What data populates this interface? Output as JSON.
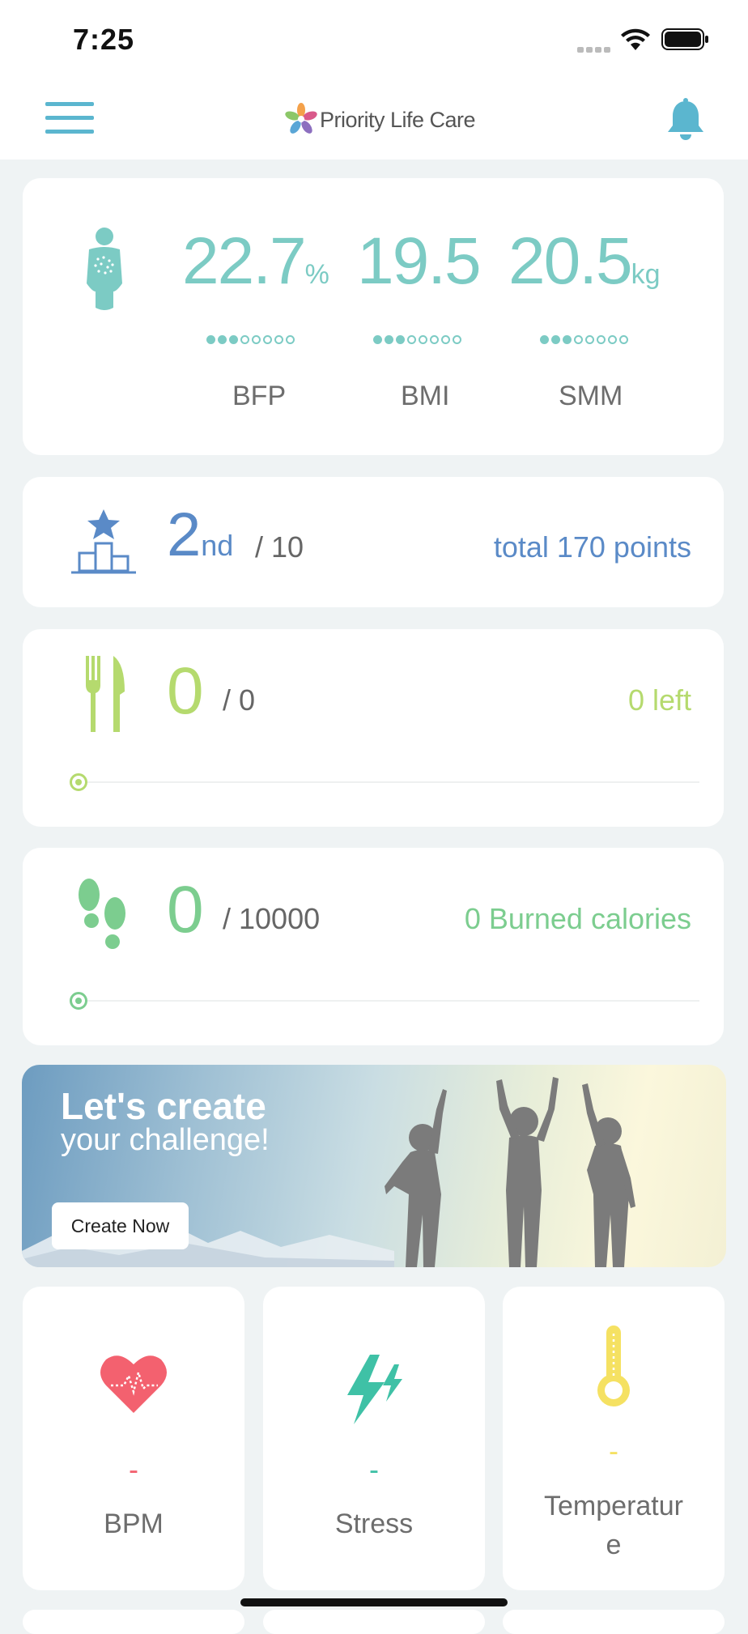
{
  "status": {
    "time": "7:25"
  },
  "header": {
    "brand": "Priority Life Care"
  },
  "body_composition": {
    "bfp": {
      "value": "22.7",
      "unit": "%",
      "label": "BFP"
    },
    "bmi": {
      "value": "19.5",
      "label": "BMI"
    },
    "smm": {
      "value": "20.5",
      "unit": "kg",
      "label": "SMM"
    }
  },
  "rank": {
    "position": "2",
    "suffix": "nd",
    "total": "/ 10",
    "points": "total 170 points"
  },
  "meal": {
    "value": "0",
    "total": "/ 0",
    "left": "0 left"
  },
  "steps": {
    "value": "0",
    "total": "/ 10000",
    "calories": "0 Burned calories"
  },
  "banner": {
    "title": "Let's create",
    "subtitle": "your challenge!",
    "button": "Create Now"
  },
  "vitals": {
    "bpm": {
      "value": "-",
      "label": "BPM"
    },
    "stress": {
      "value": "-",
      "label": "Stress"
    },
    "temperature": {
      "value": "-",
      "label_1": "Temperatur",
      "label_2": "e"
    }
  },
  "colors": {
    "teal": "#7ccbc4",
    "blue": "#5a8ac7",
    "lime": "#b5da6e",
    "green": "#7ccd8f",
    "red": "#f3616f",
    "yellow": "#f5e162"
  },
  "icons": [
    "menu-icon",
    "bell-icon",
    "body-icon",
    "podium-icon",
    "fork-knife-icon",
    "footprints-icon",
    "heart-icon",
    "lightning-icon",
    "thermometer-icon"
  ]
}
